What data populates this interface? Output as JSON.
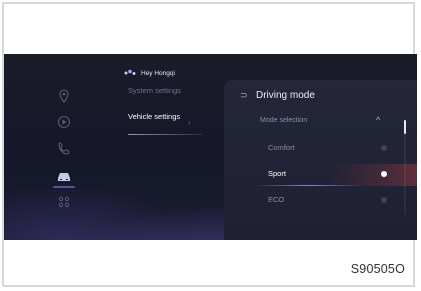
{
  "assistant": {
    "label": "Hey Hongqi",
    "icon": "voice-assistant-icon"
  },
  "left_icons": [
    {
      "name": "navigation-icon"
    },
    {
      "name": "media-icon"
    },
    {
      "name": "phone-icon"
    },
    {
      "name": "car-icon",
      "active": true
    },
    {
      "name": "apps-icon"
    }
  ],
  "menu": {
    "items": [
      {
        "label": "System settings",
        "selected": false
      },
      {
        "label": "Vehicle settings",
        "selected": true,
        "chevron": "›"
      }
    ]
  },
  "panel": {
    "back_glyph": "⊃",
    "title": "Driving mode",
    "subtitle": "Mode selection",
    "collapse_glyph": "^",
    "options": [
      {
        "label": "Comfort",
        "selected": false
      },
      {
        "label": "Sport",
        "selected": true
      },
      {
        "label": "ECO",
        "selected": false
      }
    ]
  },
  "figure_code": "S90505O"
}
